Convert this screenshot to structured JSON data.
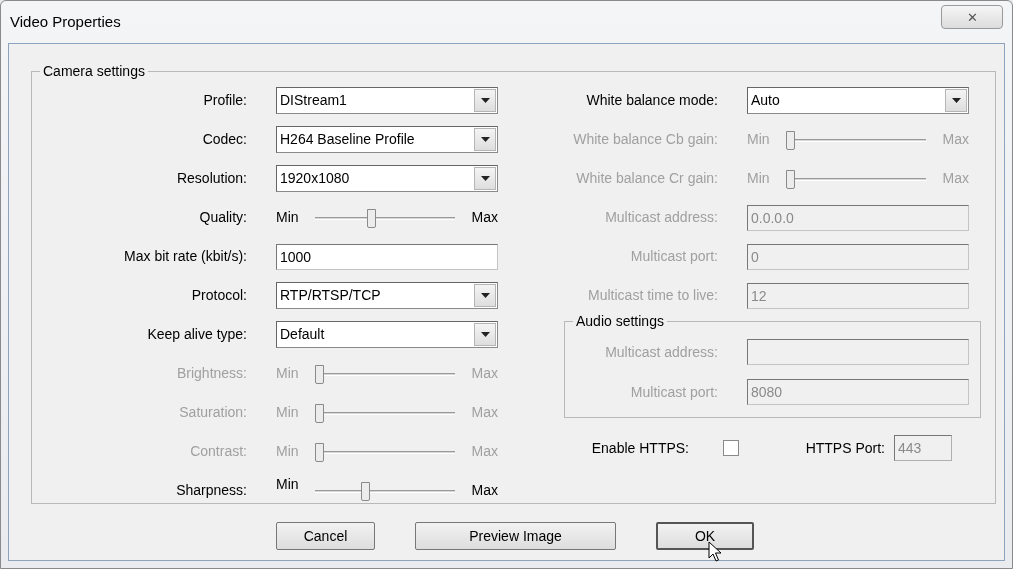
{
  "window": {
    "title": "Video Properties",
    "close_label": "✕"
  },
  "camera_settings": {
    "title": "Camera settings",
    "left": [
      {
        "kind": "dropdown",
        "label": "Profile:",
        "value": "DIStream1",
        "disabled": false
      },
      {
        "kind": "dropdown",
        "label": "Codec:",
        "value": "H264 Baseline Profile",
        "disabled": false
      },
      {
        "kind": "dropdown",
        "label": "Resolution:",
        "value": "1920x1080",
        "disabled": false
      },
      {
        "kind": "slider",
        "label": "Quality:",
        "min": "Min",
        "max": "Max",
        "level": 0.4,
        "disabled": false
      },
      {
        "kind": "text",
        "label": "Max bit rate (kbit/s):",
        "value": "1000",
        "disabled": false
      },
      {
        "kind": "dropdown",
        "label": "Protocol:",
        "value": "RTP/RTSP/TCP",
        "disabled": false
      },
      {
        "kind": "dropdown",
        "label": "Keep alive type:",
        "value": "Default",
        "disabled": false
      },
      {
        "kind": "slider",
        "label": "Brightness:",
        "min": "Min",
        "max": "Max",
        "level": 0,
        "disabled": true
      },
      {
        "kind": "slider",
        "label": "Saturation:",
        "min": "Min",
        "max": "Max",
        "level": 0,
        "disabled": true
      },
      {
        "kind": "slider",
        "label": "Contrast:",
        "min": "Min",
        "max": "Max",
        "level": 0,
        "disabled": true
      },
      {
        "kind": "slider",
        "label": "Sharpness:",
        "min": "Min",
        "max": "Max",
        "level": 0.35,
        "disabled": false
      }
    ],
    "right": [
      {
        "kind": "dropdown",
        "label": "White balance mode:",
        "value": "Auto",
        "disabled": false
      },
      {
        "kind": "slider",
        "label": "White balance Cb gain:",
        "min": "Min",
        "max": "Max",
        "level": 0,
        "disabled": true
      },
      {
        "kind": "slider",
        "label": "White balance Cr gain:",
        "min": "Min",
        "max": "Max",
        "level": 0,
        "disabled": true
      },
      {
        "kind": "text",
        "label": "Multicast address:",
        "value": "0.0.0.0",
        "disabled": true
      },
      {
        "kind": "text",
        "label": "Multicast port:",
        "value": "0",
        "disabled": true
      },
      {
        "kind": "text",
        "label": "Multicast time to live:",
        "value": "12",
        "disabled": true
      }
    ],
    "audio_settings": {
      "title": "Audio settings",
      "fields": [
        {
          "kind": "text",
          "label": "Multicast address:",
          "disabled": true
        },
        {
          "kind": "text",
          "label": "Multicast port:",
          "value": "8080",
          "disabled": true
        }
      ]
    },
    "enable_https": {
      "label": "Enable HTTPS:",
      "checked": false
    },
    "https_port": {
      "label": "HTTPS Port:",
      "value": "443",
      "disabled": true
    }
  },
  "buttons": [
    {
      "label": "Cancel",
      "focused": false
    },
    {
      "label": "Preview Image",
      "focused": false
    },
    {
      "label": "OK",
      "focused": true
    }
  ]
}
